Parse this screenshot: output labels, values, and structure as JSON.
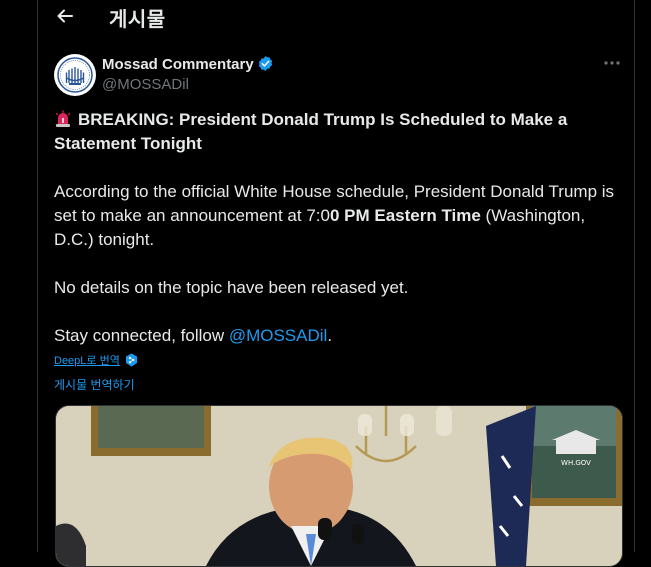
{
  "header": {
    "title": "게시물"
  },
  "author": {
    "name": "Mossad Commentary",
    "handle": "@MOSSADil"
  },
  "post": {
    "headline": "BREAKING: President Donald Trump Is Scheduled to Make a Statement Tonight",
    "p1_start": "According to the official White House schedule, President Donald Trump is set to make an announcement at 7:0",
    "p1_bold": "0 PM Eastern Time",
    "p1_end": " (Washington, D.C.) tonight.",
    "p2": "No details on the topic have been released yet.",
    "p3_start": "Stay connected, follow ",
    "p3_mention": "@MOSSADil",
    "p3_end": "."
  },
  "translation": {
    "deepl_label": "DeepL로 번역",
    "translate_label": "게시물 번역하기"
  },
  "media": {
    "watermark": "WH.GOV"
  },
  "colors": {
    "accent": "#1d9bf0",
    "background": "#000000",
    "text": "#e7e9ea",
    "muted": "#71767b"
  },
  "icons": [
    "back-arrow-icon",
    "verified-badge-icon",
    "more-icon",
    "siren-icon",
    "deepl-icon"
  ]
}
